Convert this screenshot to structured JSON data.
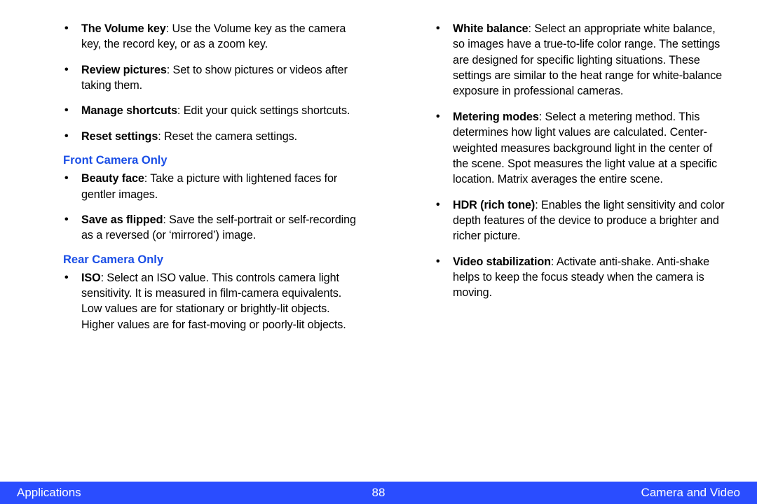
{
  "left": {
    "initial_items": [
      {
        "term": "The Volume key",
        "desc": ": Use the Volume key as the camera key, the record key, or as a zoom key."
      },
      {
        "term": "Review pictures",
        "desc": ": Set to show pictures or videos after taking them."
      },
      {
        "term": "Manage shortcuts",
        "desc": ": Edit your quick settings shortcuts."
      },
      {
        "term": "Reset settings",
        "desc": ": Reset the camera settings."
      }
    ],
    "front_heading": "Front Camera Only",
    "front_items": [
      {
        "term": "Beauty face",
        "desc": ": Take a picture with lightened faces for gentler images."
      },
      {
        "term": "Save as flipped",
        "desc": ": Save the self-portrait or self-recording as a reversed (or ‘mirrored’) image."
      }
    ],
    "rear_heading": "Rear Camera Only",
    "rear_items": [
      {
        "term": "ISO",
        "desc": ": Select an ISO value. This controls camera light sensitivity. It is measured in film-camera equivalents. Low values are for stationary or brightly-lit objects. Higher values are for fast-moving or poorly-lit objects."
      }
    ]
  },
  "right": {
    "items": [
      {
        "term": "White balance",
        "desc": ": Select an appropriate white balance, so images have a true-to-life color range. The settings are designed for specific lighting situations. These settings are similar to the heat range for white-balance exposure in professional cameras."
      },
      {
        "term": "Metering modes",
        "desc": ": Select a metering method. This determines how light values are calculated. Center-weighted measures background light in the center of the scene. Spot measures the light value at a specific location. Matrix averages the entire scene."
      },
      {
        "term": "HDR (rich tone)",
        "desc": ": Enables the light sensitivity and color depth features of the device to produce a brighter and richer picture."
      },
      {
        "term": "Video stabilization",
        "desc": ": Activate anti-shake. Anti-shake helps to keep the focus steady when the camera is moving."
      }
    ]
  },
  "footer": {
    "left": "Applications",
    "center": "88",
    "right": "Camera and Video"
  }
}
